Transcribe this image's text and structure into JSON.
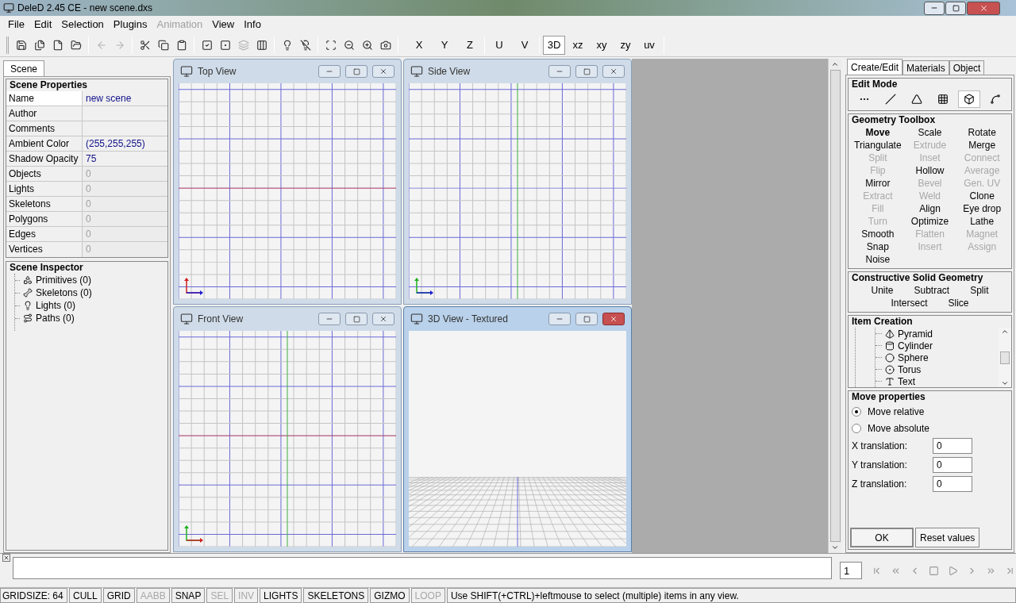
{
  "window": {
    "title": "DeleD 2.45 CE - new scene.dxs"
  },
  "menu": [
    {
      "label": "File",
      "disabled": false
    },
    {
      "label": "Edit",
      "disabled": false
    },
    {
      "label": "Selection",
      "disabled": false
    },
    {
      "label": "Plugins",
      "disabled": false
    },
    {
      "label": "Animation",
      "disabled": true
    },
    {
      "label": "View",
      "disabled": false
    },
    {
      "label": "Info",
      "disabled": false
    }
  ],
  "toolbar": {
    "groups": [
      [
        {
          "kind": "save",
          "disabled": false
        },
        {
          "kind": "save-all",
          "disabled": false
        },
        {
          "kind": "new",
          "disabled": false
        },
        {
          "kind": "open",
          "disabled": false
        }
      ],
      [
        {
          "kind": "undo",
          "disabled": true
        },
        {
          "kind": "redo",
          "disabled": true
        }
      ],
      [
        {
          "kind": "cut",
          "disabled": false
        },
        {
          "kind": "copy",
          "disabled": false
        },
        {
          "kind": "paste",
          "disabled": false
        }
      ],
      [
        {
          "kind": "select-all",
          "disabled": false
        },
        {
          "kind": "select-none",
          "disabled": false
        },
        {
          "kind": "invert",
          "disabled": true
        },
        {
          "kind": "columns",
          "disabled": false
        }
      ],
      [
        {
          "kind": "light-on",
          "disabled": false
        },
        {
          "kind": "light-off",
          "disabled": false
        }
      ],
      [
        {
          "kind": "zoom-fit",
          "disabled": false
        },
        {
          "kind": "zoom-out",
          "disabled": false
        },
        {
          "kind": "zoom-in",
          "disabled": false
        },
        {
          "kind": "camera",
          "disabled": false
        }
      ]
    ],
    "axes": [
      {
        "label": "X",
        "selected": false
      },
      {
        "label": "Y",
        "selected": false
      },
      {
        "label": "Z",
        "selected": false
      }
    ],
    "uv": [
      {
        "label": "U",
        "selected": false
      },
      {
        "label": "V",
        "selected": false
      }
    ],
    "planes": [
      {
        "label": "3D",
        "selected": true
      },
      {
        "label": "xz",
        "selected": false
      },
      {
        "label": "xy",
        "selected": false
      },
      {
        "label": "zy",
        "selected": false
      },
      {
        "label": "uv",
        "selected": false
      }
    ]
  },
  "left_panel": {
    "tab": "Scene",
    "scene_properties": {
      "title": "Scene Properties",
      "rows": [
        {
          "label": "Name",
          "value": "new scene",
          "readonly": false,
          "selected": true
        },
        {
          "label": "Author",
          "selected": false
        },
        {
          "label": "Comments",
          "selected": false
        },
        {
          "label": "Ambient Color",
          "value": "(255,255,255)",
          "readonly": false,
          "selected": false
        },
        {
          "label": "Shadow Opacity",
          "value": "75",
          "readonly": false,
          "selected": false
        },
        {
          "label": "Objects",
          "value": "0",
          "readonly": true,
          "selected": false
        },
        {
          "label": "Lights",
          "value": "0",
          "readonly": true,
          "selected": false
        },
        {
          "label": "Skeletons",
          "value": "0",
          "readonly": true,
          "selected": false
        },
        {
          "label": "Polygons",
          "value": "0",
          "readonly": true,
          "selected": false
        },
        {
          "label": "Edges",
          "value": "0",
          "readonly": true,
          "selected": false
        },
        {
          "label": "Vertices",
          "value": "0",
          "readonly": true,
          "selected": false
        }
      ]
    },
    "scene_inspector": {
      "title": "Scene Inspector",
      "items": [
        {
          "label": "Primitives (0)",
          "kind": "primitives"
        },
        {
          "label": "Skeletons (0)",
          "kind": "skeletons"
        },
        {
          "label": "Lights (0)",
          "kind": "lights"
        },
        {
          "label": "Paths (0)",
          "kind": "paths"
        }
      ]
    }
  },
  "viewports": [
    {
      "title": "Top View",
      "kind": "top",
      "active": false
    },
    {
      "title": "Side View",
      "kind": "side",
      "active": false
    },
    {
      "title": "Front View",
      "kind": "front",
      "active": false
    },
    {
      "title": "3D View - Textured",
      "kind": "perspective",
      "active": true
    }
  ],
  "right_panel": {
    "tabs": [
      {
        "label": "Create/Edit",
        "selected": true
      },
      {
        "label": "Materials",
        "selected": false
      },
      {
        "label": "Object",
        "selected": false
      }
    ],
    "edit_mode": {
      "title": "Edit Mode",
      "modes": [
        {
          "kind": "vertex",
          "selected": false
        },
        {
          "kind": "edge",
          "selected": false
        },
        {
          "kind": "polygon",
          "selected": false
        },
        {
          "kind": "texture",
          "selected": false
        },
        {
          "kind": "object",
          "selected": true
        },
        {
          "kind": "bone",
          "selected": false
        }
      ]
    },
    "geometry_toolbox": {
      "title": "Geometry Toolbox",
      "tools": [
        {
          "label": "Move",
          "disabled": false,
          "selected": true
        },
        {
          "label": "Scale",
          "disabled": false,
          "selected": false
        },
        {
          "label": "Rotate",
          "disabled": false,
          "selected": false
        },
        {
          "label": "Triangulate",
          "disabled": false,
          "selected": false
        },
        {
          "label": "Extrude",
          "disabled": true,
          "selected": false
        },
        {
          "label": "Merge",
          "disabled": false,
          "selected": false
        },
        {
          "label": "Split",
          "disabled": true,
          "selected": false
        },
        {
          "label": "Inset",
          "disabled": true,
          "selected": false
        },
        {
          "label": "Connect",
          "disabled": true,
          "selected": false
        },
        {
          "label": "Flip",
          "disabled": true,
          "selected": false
        },
        {
          "label": "Hollow",
          "disabled": false,
          "selected": false
        },
        {
          "label": "Average",
          "disabled": true,
          "selected": false
        },
        {
          "label": "Mirror",
          "disabled": false,
          "selected": false
        },
        {
          "label": "Bevel",
          "disabled": true,
          "selected": false
        },
        {
          "label": "Gen. UV",
          "disabled": true,
          "selected": false
        },
        {
          "label": "Extract",
          "disabled": true,
          "selected": false
        },
        {
          "label": "Weld",
          "disabled": true,
          "selected": false
        },
        {
          "label": "Clone",
          "disabled": false,
          "selected": false
        },
        {
          "label": "Fill",
          "disabled": true,
          "selected": false
        },
        {
          "label": "Align",
          "disabled": false,
          "selected": false
        },
        {
          "label": "Eye drop",
          "disabled": false,
          "selected": false
        },
        {
          "label": "Turn",
          "disabled": true,
          "selected": false
        },
        {
          "label": "Optimize",
          "disabled": false,
          "selected": false
        },
        {
          "label": "Lathe",
          "disabled": false,
          "selected": false
        },
        {
          "label": "Smooth",
          "disabled": false,
          "selected": false
        },
        {
          "label": "Flatten",
          "disabled": true,
          "selected": false
        },
        {
          "label": "Magnet",
          "disabled": true,
          "selected": false
        },
        {
          "label": "Snap",
          "disabled": false,
          "selected": false
        },
        {
          "label": "Insert",
          "disabled": true,
          "selected": false
        },
        {
          "label": "Assign",
          "disabled": true,
          "selected": false
        },
        {
          "label": "Noise",
          "disabled": false,
          "selected": false
        }
      ]
    },
    "csg": {
      "title": "Constructive Solid Geometry",
      "rows": [
        [
          "Unite",
          "Subtract",
          "Split"
        ],
        [
          "Intersect",
          "Slice"
        ]
      ]
    },
    "item_creation": {
      "title": "Item Creation",
      "items": [
        {
          "label": "Pyramid",
          "kind": "pyramid"
        },
        {
          "label": "Cylinder",
          "kind": "cylinder"
        },
        {
          "label": "Sphere",
          "kind": "sphere"
        },
        {
          "label": "Torus",
          "kind": "torus"
        },
        {
          "label": "Text",
          "kind": "text"
        }
      ]
    },
    "move_properties": {
      "title": "Move properties",
      "options": [
        {
          "label": "Move relative",
          "selected": true
        },
        {
          "label": "Move absolute",
          "selected": false
        }
      ],
      "fields": [
        {
          "label": "X translation:",
          "value": "0"
        },
        {
          "label": "Y translation:",
          "value": "0"
        },
        {
          "label": "Z translation:",
          "value": "0"
        }
      ],
      "buttons": [
        "OK",
        "Reset values"
      ]
    }
  },
  "timeline": {
    "frame": "1"
  },
  "status_bar": {
    "gridsize": "GRIDSIZE: 64",
    "toggles": [
      {
        "label": "CULL",
        "on": true
      },
      {
        "label": "GRID",
        "on": true
      },
      {
        "label": "AABB",
        "on": false
      },
      {
        "label": "SNAP",
        "on": true
      },
      {
        "label": "SEL",
        "on": false
      },
      {
        "label": "INV",
        "on": false
      },
      {
        "label": "LIGHTS",
        "on": true
      },
      {
        "label": "SKELETONS",
        "on": true
      },
      {
        "label": "GIZMO",
        "on": true
      },
      {
        "label": "LOOP",
        "on": false
      }
    ],
    "message": "Use SHIFT(+CTRL)+leftmouse to select (multiple) items in any view."
  }
}
